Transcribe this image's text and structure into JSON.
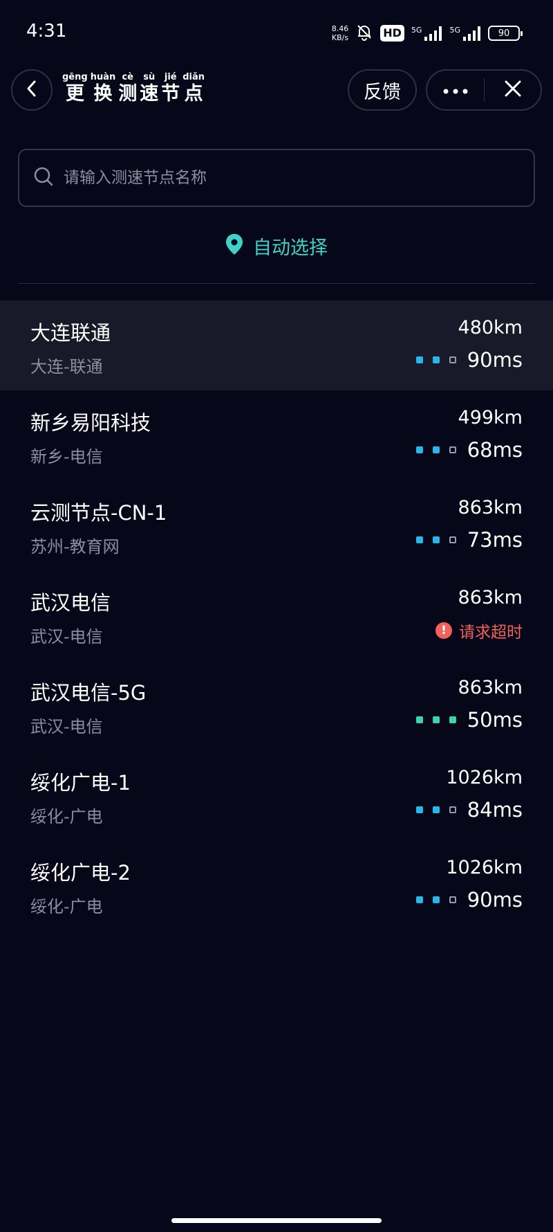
{
  "status_bar": {
    "time": "4:31",
    "net_speed_value": "8.46",
    "net_speed_unit": "KB/s",
    "hd_badge": "HD",
    "sig1_label": "5G",
    "sig2_label": "5G",
    "battery": "90"
  },
  "header": {
    "title": [
      {
        "pinyin": "gēng",
        "char": "更"
      },
      {
        "pinyin": "huàn",
        "char": "换"
      },
      {
        "pinyin": "cè",
        "char": "测"
      },
      {
        "pinyin": "sù",
        "char": "速"
      },
      {
        "pinyin": "jié",
        "char": "节"
      },
      {
        "pinyin": "diǎn",
        "char": "点"
      }
    ],
    "feedback_label": "反馈"
  },
  "search": {
    "placeholder": "请输入测速节点名称"
  },
  "auto_select": {
    "label": "自动选择"
  },
  "colors": {
    "accent": "#3ed2c8",
    "dot_active": "#25b8ee",
    "dot_good": "#3ed2aa",
    "error": "#f0625a",
    "background": "#07071a"
  },
  "nodes": [
    {
      "name": "大连联通",
      "location": "大连-联通",
      "distance": "480km",
      "latency": "90ms",
      "signal_level": 2,
      "signal_max": 3,
      "quality": "normal",
      "selected": true
    },
    {
      "name": "新乡易阳科技",
      "location": "新乡-电信",
      "distance": "499km",
      "latency": "68ms",
      "signal_level": 2,
      "signal_max": 3,
      "quality": "normal",
      "selected": false
    },
    {
      "name": "云测节点-CN-1",
      "location": "苏州-教育网",
      "distance": "863km",
      "latency": "73ms",
      "signal_level": 2,
      "signal_max": 3,
      "quality": "normal",
      "selected": false
    },
    {
      "name": "武汉电信",
      "location": "武汉-电信",
      "distance": "863km",
      "latency": "",
      "timeout_text": "请求超时",
      "signal_level": 0,
      "signal_max": 3,
      "quality": "timeout",
      "selected": false
    },
    {
      "name": "武汉电信-5G",
      "location": "武汉-电信",
      "distance": "863km",
      "latency": "50ms",
      "signal_level": 3,
      "signal_max": 3,
      "quality": "good",
      "selected": false
    },
    {
      "name": "绥化广电-1",
      "location": "绥化-广电",
      "distance": "1026km",
      "latency": "84ms",
      "signal_level": 2,
      "signal_max": 3,
      "quality": "normal",
      "selected": false
    },
    {
      "name": "绥化广电-2",
      "location": "绥化-广电",
      "distance": "1026km",
      "latency": "90ms",
      "signal_level": 2,
      "signal_max": 3,
      "quality": "normal",
      "selected": false
    }
  ]
}
